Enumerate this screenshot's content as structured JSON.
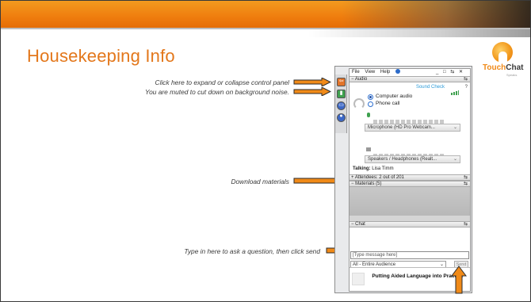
{
  "slide": {
    "title": "Housekeeping Info"
  },
  "logo": {
    "brand_touch": "Touch",
    "brand_chat": "Chat",
    "tagline": "Speaks"
  },
  "annotations": {
    "expand_panel": "Click here to expand or collapse control panel",
    "muted": "You are muted to cut down on background noise.",
    "download": "Download materials",
    "ask_question": "Type in here to ask a question, then click send"
  },
  "control_panel": {
    "menu": [
      "File",
      "View",
      "Help"
    ],
    "window_controls": "_ □ ⇆ ✕",
    "audio": {
      "header": "Audio",
      "sound_check": "Sound Check",
      "help": "?",
      "options": [
        {
          "label": "Computer audio",
          "selected": true
        },
        {
          "label": "Phone call",
          "selected": false
        }
      ],
      "microphone": "Microphone (HD Pro Webcam...",
      "speakers": "Speakers / Headphones (Realt...",
      "talking_label": "Talking:",
      "talking_name": "Lisa Timm"
    },
    "attendees": {
      "header": "Attendees:",
      "count": "2 out of 201"
    },
    "materials": {
      "header": "Materials (5)"
    },
    "chat": {
      "header": "Chat",
      "input_placeholder": "[Type message here]",
      "audience": "All - Entire Audience",
      "send": "Send"
    },
    "session_title": "Putting Aided Language into Practice"
  },
  "colors": {
    "accent_orange": "#e3771b",
    "arrow_orange": "#f08a18",
    "link_blue": "#2d9bd8"
  }
}
